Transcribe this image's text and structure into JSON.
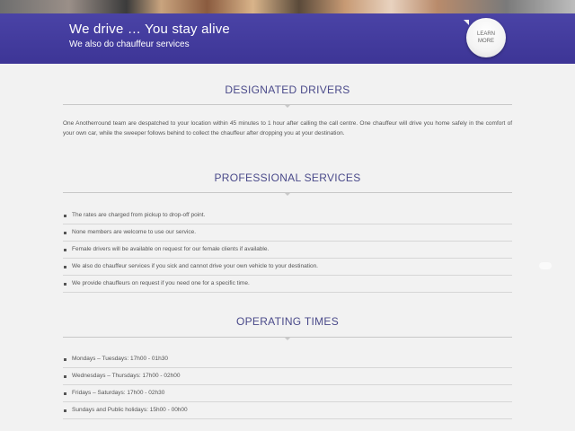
{
  "banner": {
    "title": "We drive … You stay alive",
    "subtitle": "We also do chauffeur services",
    "learn_more_label": "LEARN MORE"
  },
  "sections": {
    "designated": {
      "title": "DESIGNATED DRIVERS",
      "body": "One Anotherround team are despatched to your location within 45 minutes to 1 hour after calling the call centre. One chauffeur will drive you home safely in the comfort of your own car, while the sweeper follows behind to collect the chauffeur after dropping you at your destination."
    },
    "professional": {
      "title": "PROFESSIONAL SERVICES",
      "items": [
        "The rates are charged from pickup to drop-off point.",
        "None members are welcome to use our service.",
        "Female drivers will be available on request for our female clients if available.",
        "We also do chauffeur services if you sick and cannot drive your own vehicle to your destination.",
        "We provide chauffeurs on request if you need one for a specific time."
      ]
    },
    "operating": {
      "title": "OPERATING TIMES",
      "items": [
        "Mondays – Tuesdays: 17h00 - 01h30",
        "Wednesdays – Thursdays: 17h00 - 02h00",
        "Fridays – Saturdays: 17h00 - 02h30",
        "Sundays and Public holidays: 15h00 - 00h00"
      ]
    }
  },
  "colors": {
    "banner": "#4a43a6",
    "section_title": "#4a4a8a",
    "background": "#f2f2f2"
  }
}
